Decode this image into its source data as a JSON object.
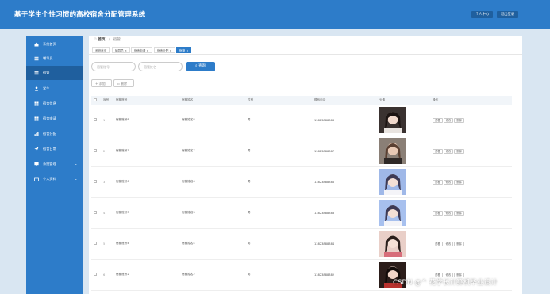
{
  "header": {
    "title": "基于学生个性习惯的高校宿舍分配管理系统",
    "profile_label": "个人中心",
    "logout_label": "退出登录"
  },
  "sidebar": {
    "items": [
      {
        "label": "系统首页",
        "icon": "home-icon"
      },
      {
        "label": "辅导员",
        "icon": "list-icon"
      },
      {
        "label": "宿管",
        "icon": "list-icon",
        "active": true
      },
      {
        "label": "学生",
        "icon": "person-icon"
      },
      {
        "label": "宿舍信息",
        "icon": "grid-icon"
      },
      {
        "label": "宿舍申请",
        "icon": "grid-icon"
      },
      {
        "label": "宿舍分配",
        "icon": "chart-icon"
      },
      {
        "label": "宿舍日常",
        "icon": "send-icon"
      },
      {
        "label": "系统管理",
        "icon": "monitor-icon",
        "has_children": true
      },
      {
        "label": "个人资料",
        "icon": "calendar-icon",
        "has_children": true
      }
    ]
  },
  "breadcrumb": {
    "home": "首页",
    "current": "宿管"
  },
  "tabs": [
    {
      "label": "系统首页"
    },
    {
      "label": "辅导员 ×"
    },
    {
      "label": "宿舍申请 ×"
    },
    {
      "label": "宿舍分配 ×"
    },
    {
      "label": "宿管 ×",
      "active": true
    }
  ],
  "search": {
    "placeholder_1": "宿管账号",
    "placeholder_2": "宿管姓名",
    "button_label": "查询"
  },
  "actions": {
    "add_label": "添加",
    "delete_label": "删除"
  },
  "table": {
    "headers": [
      "",
      "序号",
      "宿管账号",
      "宿管姓名",
      "性别",
      "联系电话",
      "头像",
      "操作"
    ],
    "row_buttons": [
      "查看",
      "修改",
      "删除"
    ],
    "rows": [
      {
        "index": "1",
        "account": "宿管账号8",
        "name": "宿管姓名8",
        "gender": "男",
        "phone": "13823888888",
        "avatar": "avatar-girl-dark"
      },
      {
        "index": "2",
        "account": "宿管账号7",
        "name": "宿管姓名7",
        "gender": "男",
        "phone": "13823888887",
        "avatar": "avatar-girl-brown"
      },
      {
        "index": "3",
        "account": "宿管账号6",
        "name": "宿管姓名6",
        "gender": "男",
        "phone": "13823888886",
        "avatar": "avatar-girl-blue"
      },
      {
        "index": "4",
        "account": "宿管账号3",
        "name": "宿管姓名3",
        "gender": "男",
        "phone": "13823888883",
        "avatar": "avatar-girl-blue"
      },
      {
        "index": "5",
        "account": "宿管账号4",
        "name": "宿管姓名4",
        "gender": "男",
        "phone": "13823888884",
        "avatar": "avatar-girl-pink"
      },
      {
        "index": "6",
        "account": "宿管账号2",
        "name": "宿管姓名2",
        "gender": "男",
        "phone": "13823888882",
        "avatar": "avatar-girl-red"
      }
    ]
  },
  "watermark": "CSDN @^ 花学长计算机毕业设计",
  "colors": {
    "primary": "#2d7cc9",
    "primary_dark": "#1f5f9e",
    "background": "#d9e6f2"
  }
}
